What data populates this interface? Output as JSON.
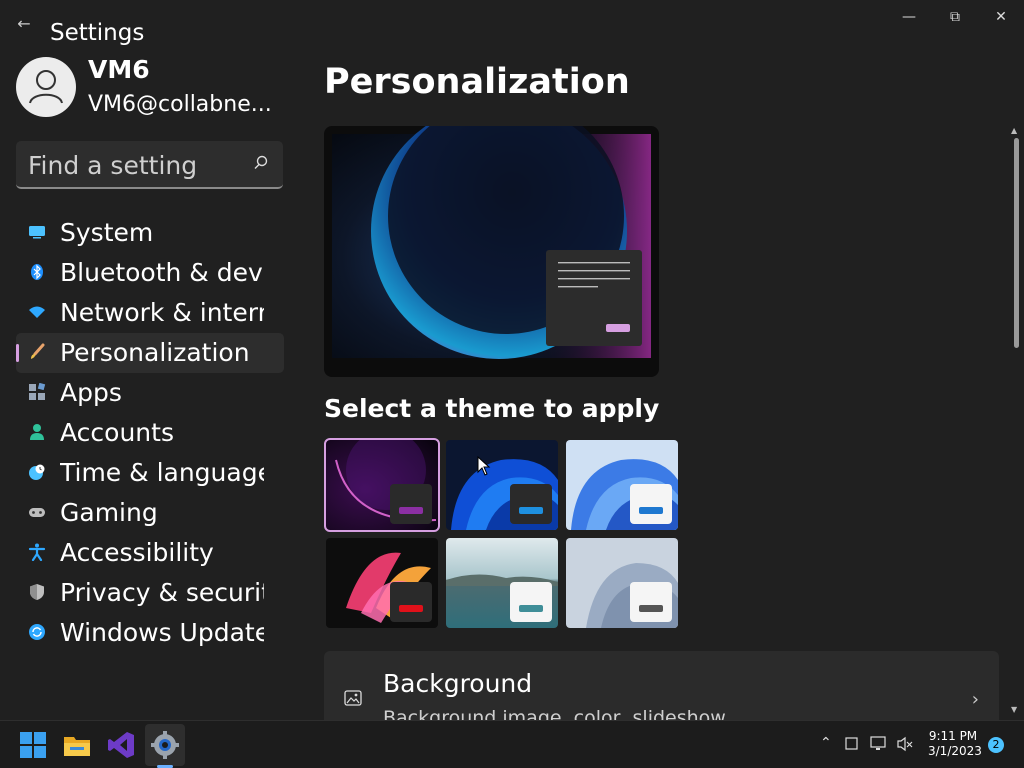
{
  "app": {
    "title": "Settings"
  },
  "user": {
    "name": "VM6",
    "email": "VM6@collabne..."
  },
  "search": {
    "placeholder": "Find a setting"
  },
  "nav": {
    "items": [
      {
        "label": "System",
        "icon": "monitor-icon",
        "color": "#4cc2ff"
      },
      {
        "label": "Bluetooth & devi",
        "icon": "bluetooth-icon",
        "color": "#1e90ff"
      },
      {
        "label": "Network & interr",
        "icon": "wifi-icon",
        "color": "#2ea8ff"
      },
      {
        "label": "Personalization",
        "icon": "brush-icon",
        "color": "#e8a36b"
      },
      {
        "label": "Apps",
        "icon": "apps-icon",
        "color": "#9aa7b8"
      },
      {
        "label": "Accounts",
        "icon": "person-icon",
        "color": "#2fc29a"
      },
      {
        "label": "Time & language",
        "icon": "globe-clock-icon",
        "color": "#4cc2ff"
      },
      {
        "label": "Gaming",
        "icon": "gamepad-icon",
        "color": "#bdbdbd"
      },
      {
        "label": "Accessibility",
        "icon": "accessibility-icon",
        "color": "#2ea8ff"
      },
      {
        "label": "Privacy & securit",
        "icon": "shield-icon",
        "color": "#bfbfbf"
      },
      {
        "label": "Windows Update",
        "icon": "update-icon",
        "color": "#2ea8ff"
      }
    ],
    "selected": "Personalization"
  },
  "main": {
    "title": "Personalization",
    "themes_heading": "Select a theme to apply",
    "themes": [
      {
        "name": "theme-dark-bloom-purple",
        "selected": true
      },
      {
        "name": "theme-dark-bloom-blue",
        "selected": false
      },
      {
        "name": "theme-light-bloom-blue",
        "selected": false
      },
      {
        "name": "theme-glow",
        "selected": false
      },
      {
        "name": "theme-captured-motion",
        "selected": false
      },
      {
        "name": "theme-flow",
        "selected": false
      }
    ],
    "background_card": {
      "title": "Background",
      "subtitle": "Background image, color, slideshow"
    }
  },
  "taskbar": {
    "apps": [
      "windows-start-icon",
      "file-explorer-icon",
      "visual-studio-icon",
      "settings-icon"
    ],
    "clock_time": "9:11 PM",
    "clock_date": "3/1/2023",
    "notification_count": "2"
  },
  "colors": {
    "accent": "#d69fe1",
    "background": "#202020",
    "card": "#2b2b2b"
  }
}
